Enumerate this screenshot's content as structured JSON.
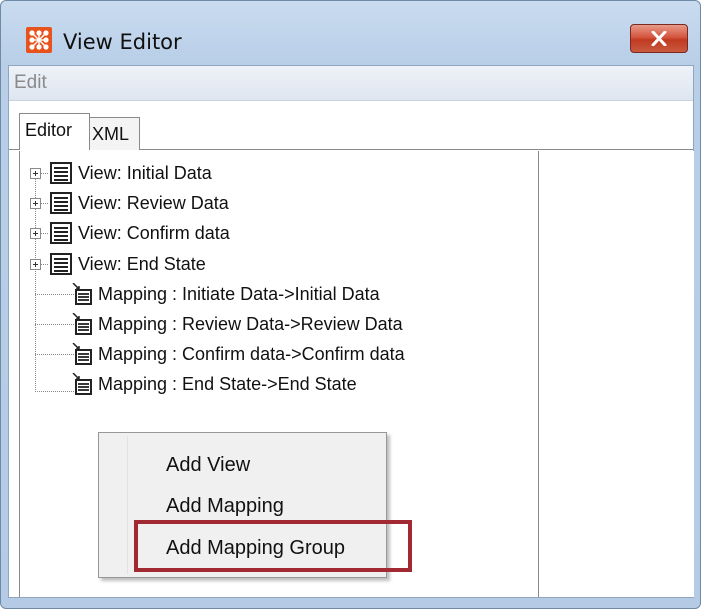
{
  "window": {
    "title": "View Editor",
    "accent": "#e8531d",
    "close_color": "#c13a22"
  },
  "menubar": {
    "edit_label": "Edit"
  },
  "tabs": [
    {
      "label": "Editor"
    },
    {
      "label": "XML"
    }
  ],
  "tree": {
    "items": [
      {
        "label": "View: Initial Data",
        "type": "view"
      },
      {
        "label": "View: Review Data",
        "type": "view"
      },
      {
        "label": "View: Confirm data",
        "type": "view"
      },
      {
        "label": "View: End State",
        "type": "view"
      },
      {
        "label": "Mapping : Initiate Data->Initial Data",
        "type": "mapping"
      },
      {
        "label": "Mapping : Review Data->Review Data",
        "type": "mapping"
      },
      {
        "label": "Mapping : Confirm data->Confirm data",
        "type": "mapping"
      },
      {
        "label": "Mapping : End State->End State",
        "type": "mapping"
      }
    ]
  },
  "context_menu": {
    "items": [
      {
        "label": "Add View"
      },
      {
        "label": "Add Mapping"
      },
      {
        "label": "Add Mapping Group"
      }
    ],
    "highlight_color": "#a12932"
  }
}
